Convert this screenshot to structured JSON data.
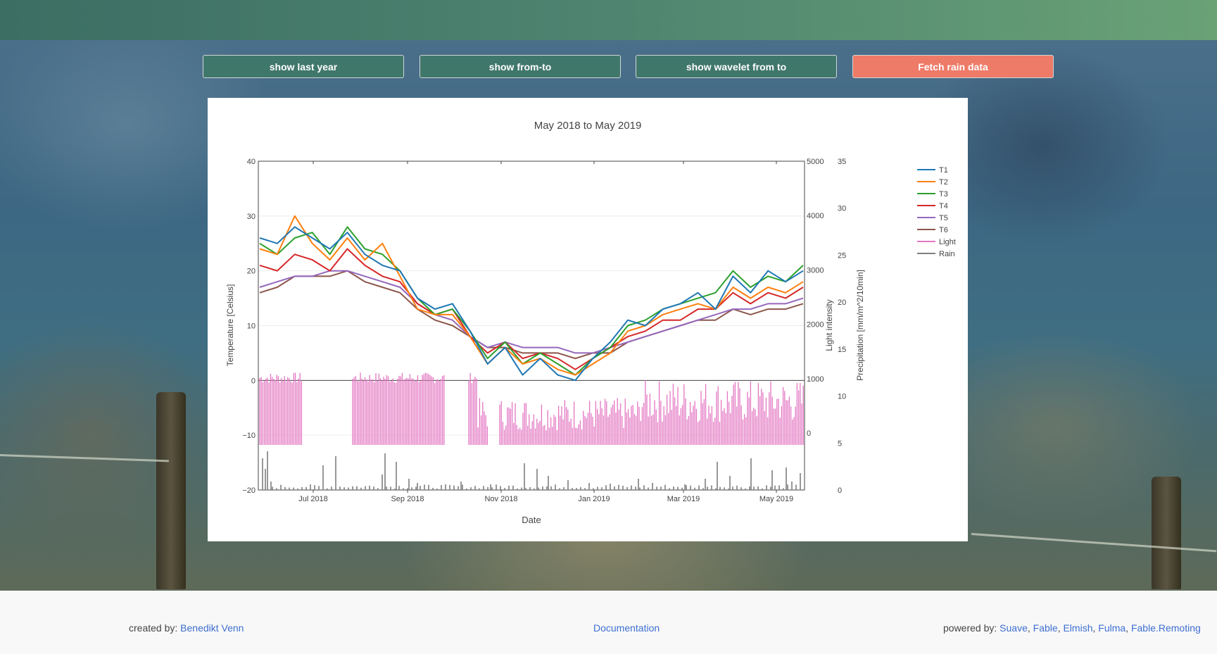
{
  "buttons": {
    "last_year": "show last year",
    "from_to": "show from-to",
    "wavelet": "show wavelet from to",
    "rain": "Fetch rain data"
  },
  "colors": {
    "header_start": "#3c6e63",
    "header_end": "#6aa276",
    "button_green": "#40776b",
    "button_red": "#ee7a68",
    "link": "#3d6fd1"
  },
  "chart_data": {
    "type": "line",
    "title": "May 2018 to May 2019",
    "xlabel": "Date",
    "ylabel_left": "Temperature [Celsius]",
    "ylabel_light": "Light intensity",
    "ylabel_rain": "Precipitation [mm/m^2/10min]",
    "x_ticks": [
      "Jul 2018",
      "Sep 2018",
      "Nov 2018",
      "Jan 2019",
      "Mar 2019",
      "May 2019"
    ],
    "y_left_ticks": [
      "40",
      "30",
      "20",
      "10",
      "0",
      "−10",
      "−20"
    ],
    "y_left_range": [
      -20,
      40
    ],
    "y_light_ticks": [
      "5000",
      "4000",
      "3000",
      "2000",
      "1000",
      "0"
    ],
    "y_rain_ticks": [
      "35",
      "30",
      "25",
      "20",
      "15",
      "10",
      "5",
      "0"
    ],
    "y_rain_range": [
      0,
      35
    ],
    "legend_position": "right",
    "grid": true,
    "series": [
      {
        "name": "T1",
        "color": "#1f77b4",
        "values": [
          26,
          25,
          28,
          26,
          24,
          27,
          23,
          21,
          20,
          15,
          13,
          14,
          9,
          3,
          6,
          1,
          4,
          1,
          0,
          4,
          7,
          11,
          10,
          13,
          14,
          16,
          13,
          19,
          16,
          20,
          18,
          20
        ]
      },
      {
        "name": "T2",
        "color": "#ff7f0e",
        "values": [
          24,
          23,
          30,
          25,
          22,
          26,
          22,
          25,
          19,
          13,
          12,
          12,
          8,
          3,
          6,
          3,
          4,
          2,
          1,
          3,
          5,
          9,
          10,
          12,
          13,
          14,
          13,
          17,
          15,
          17,
          16,
          18
        ]
      },
      {
        "name": "T3",
        "color": "#2ca02c",
        "values": [
          25,
          23,
          26,
          27,
          23,
          28,
          24,
          23,
          20,
          15,
          12,
          13,
          9,
          4,
          7,
          3,
          5,
          3,
          1,
          4,
          6,
          10,
          11,
          13,
          14,
          15,
          16,
          20,
          17,
          19,
          18,
          21
        ]
      },
      {
        "name": "T4",
        "color": "#d62728",
        "values": [
          21,
          20,
          23,
          22,
          20,
          24,
          21,
          19,
          18,
          14,
          12,
          13,
          8,
          5,
          7,
          4,
          5,
          4,
          2,
          4,
          6,
          8,
          9,
          11,
          11,
          13,
          13,
          16,
          14,
          16,
          15,
          17
        ]
      },
      {
        "name": "T5",
        "color": "#9467bd",
        "values": [
          17,
          18,
          19,
          19,
          20,
          20,
          19,
          18,
          17,
          14,
          12,
          11,
          8,
          6,
          7,
          6,
          6,
          6,
          5,
          5,
          6,
          7,
          8,
          9,
          10,
          11,
          12,
          13,
          13,
          14,
          14,
          15
        ]
      },
      {
        "name": "T6",
        "color": "#8c564b",
        "values": [
          16,
          17,
          19,
          19,
          19,
          20,
          18,
          17,
          16,
          13,
          11,
          10,
          8,
          6,
          6,
          5,
          5,
          5,
          4,
          5,
          5,
          7,
          8,
          9,
          10,
          11,
          11,
          13,
          12,
          13,
          13,
          14
        ]
      },
      {
        "name": "Light",
        "color": "#e377c2",
        "values": []
      },
      {
        "name": "Rain",
        "color": "#7f7f7f",
        "values": []
      }
    ]
  },
  "footer": {
    "created_label": "created by: ",
    "author": "Benedikt Venn",
    "docs": "Documentation",
    "powered_label": "powered by: ",
    "powered_links": [
      "Suave",
      "Fable",
      "Elmish",
      "Fulma",
      "Fable.Remoting"
    ]
  }
}
